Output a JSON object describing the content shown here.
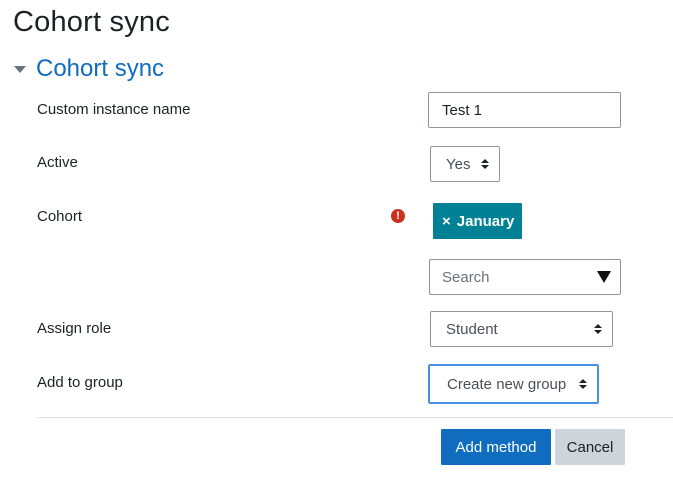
{
  "page": {
    "title": "Cohort sync"
  },
  "section": {
    "title": "Cohort sync",
    "collapse_icon": "chevron-down-icon"
  },
  "fields": {
    "instance_name": {
      "label": "Custom instance name",
      "value": "Test 1"
    },
    "active": {
      "label": "Active",
      "value": "Yes"
    },
    "cohort": {
      "label": "Cohort",
      "error_icon": "exclamation-circle-icon",
      "selected": [
        {
          "remove": "×",
          "name": "January"
        }
      ],
      "search_placeholder": "Search",
      "error_color": "#ca3120",
      "tag_color": "#008196"
    },
    "assign_role": {
      "label": "Assign role",
      "value": "Student"
    },
    "add_to_group": {
      "label": "Add to group",
      "value": "Create new group"
    }
  },
  "buttons": {
    "submit": "Add method",
    "cancel": "Cancel"
  },
  "colors": {
    "accent": "#0f6cbf",
    "focus": "#4a90e2"
  }
}
